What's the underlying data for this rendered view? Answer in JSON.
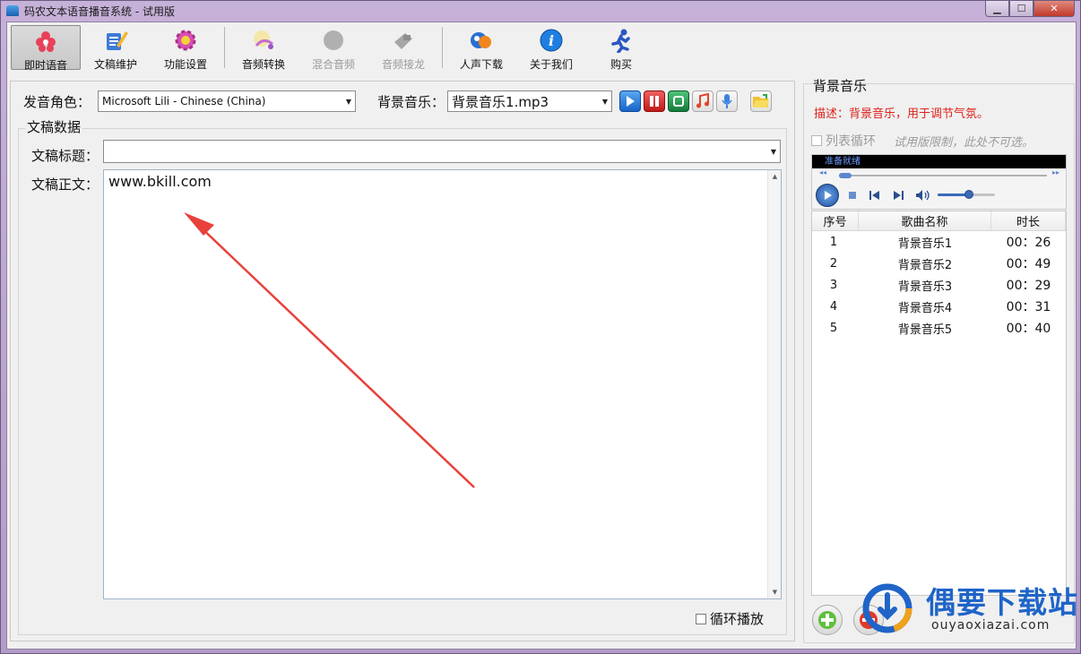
{
  "window": {
    "title": "码农文本语音播音系统 - 试用版",
    "controls": {
      "minimize": "▁",
      "maximize": "☐",
      "close": "✕"
    }
  },
  "toolbar": {
    "items": [
      {
        "label": "即时语音",
        "icon": "flower-icon",
        "active": true,
        "enabled": true
      },
      {
        "label": "文稿维护",
        "icon": "notepad-pencil-icon",
        "active": false,
        "enabled": true
      },
      {
        "label": "功能设置",
        "icon": "gear-icon",
        "active": false,
        "enabled": true
      },
      {
        "label": "音频转换",
        "icon": "audio-convert-icon",
        "active": false,
        "enabled": true
      },
      {
        "label": "混合音频",
        "icon": "mix-audio-icon",
        "active": false,
        "enabled": false
      },
      {
        "label": "音频接龙",
        "icon": "audio-chain-icon",
        "active": false,
        "enabled": false
      },
      {
        "label": "人声下载",
        "icon": "voice-download-icon",
        "active": false,
        "enabled": true
      },
      {
        "label": "关于我们",
        "icon": "info-icon",
        "active": false,
        "enabled": true
      },
      {
        "label": "购买",
        "icon": "running-man-icon",
        "active": false,
        "enabled": true
      }
    ]
  },
  "speech": {
    "voice_label": "发音角色：",
    "voice_value": "Microsoft Lili - Chinese (China)",
    "bgm_label": "背景音乐：",
    "bgm_value": "背景音乐1.mp3",
    "media_buttons": [
      "play-icon",
      "pause-icon",
      "stop-icon",
      "music-note-icon",
      "microphone-icon",
      "open-folder-icon"
    ]
  },
  "document": {
    "group_title": "文稿数据",
    "title_label": "文稿标题：",
    "title_value": "",
    "body_label": "文稿正文：",
    "body_value": "www.bkill.com",
    "loop_label": "循环播放",
    "loop_checked": false
  },
  "bgm_panel": {
    "title": "背景音乐",
    "description": "描述：背景音乐，用于调节气氛。",
    "list_loop_label": "列表循环",
    "trial_note": "试用版限制，此处不可选。",
    "player_status": "准备就绪",
    "seek_start": "◂◂",
    "seek_end": "▸▸",
    "volume_level": 0.5
  },
  "playlist": {
    "headers": [
      "序号",
      "歌曲名称",
      "时长"
    ],
    "rows": [
      {
        "no": "1",
        "name": "背景音乐1",
        "duration": "00：26"
      },
      {
        "no": "2",
        "name": "背景音乐2",
        "duration": "00：49"
      },
      {
        "no": "3",
        "name": "背景音乐3",
        "duration": "00：29"
      },
      {
        "no": "4",
        "name": "背景音乐4",
        "duration": "00：31"
      },
      {
        "no": "5",
        "name": "背景音乐5",
        "duration": "00：40"
      }
    ]
  },
  "watermark": {
    "text": "偶要下载站",
    "url": "ouyaoxiazai.com"
  },
  "colors": {
    "accent_blue": "#1f64c8",
    "description_red": "#e0201a",
    "annotation_arrow": "#e8413c"
  }
}
